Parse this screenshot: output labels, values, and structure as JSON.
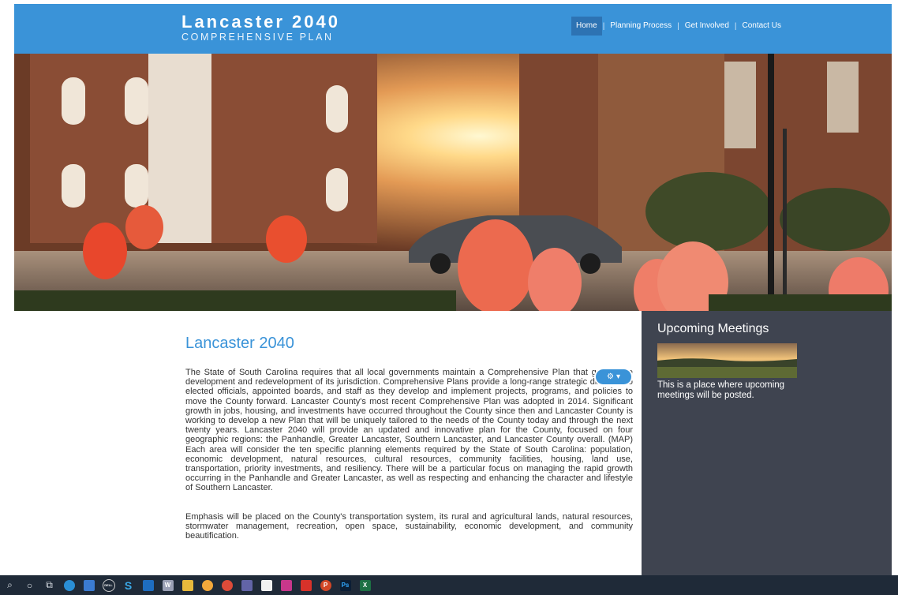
{
  "header": {
    "title": "Lancaster 2040",
    "subtitle": "COMPREHENSIVE PLAN",
    "nav": [
      {
        "label": "Home"
      },
      {
        "label": "Planning Process"
      },
      {
        "label": "Get Involved"
      },
      {
        "label": "Contact Us"
      }
    ],
    "separator": "|"
  },
  "main": {
    "title": "Lancaster 2040",
    "paragraphs": [
      "The State of South Carolina requires that all local governments maintain a Comprehensive Plan that guides the development and redevelopment of its jurisdiction. Comprehensive Plans provide a long-range strategic direction to elected officials, appointed boards, and staff as they develop and implement projects, programs, and policies to move the County forward. Lancaster County's most recent Comprehensive Plan was adopted in 2014. Significant growth in jobs, housing, and investments have occurred throughout the County since then and Lancaster County is working to develop a new Plan that will be uniquely tailored to the needs of the County today and through the next twenty years. Lancaster 2040 will provide an updated and innovative plan for the County, focused on four geographic regions: the Panhandle, Greater Lancaster, Southern Lancaster, and Lancaster County overall. (MAP) Each area will consider the ten specific planning elements required by the State of South Carolina: population, economic development, natural resources, cultural resources, community facilities, housing, land use, transportation, priority investments, and resiliency. There will be a particular focus on managing the rapid growth occurring in the Panhandle and Greater Lancaster, as well as respecting and enhancing the character and lifestyle of Southern Lancaster.",
      "Emphasis will be placed on the County's transportation system, its rural and agricultural lands, natural resources, stormwater management, recreation, open space, sustainability, economic development, and community beautification."
    ],
    "gear_caret": "▾"
  },
  "sidebar": {
    "title": "Upcoming Meetings",
    "text": "This is a place where upcoming meetings will be posted."
  },
  "taskbar": {
    "icons": [
      "search-icon",
      "cortana-icon",
      "task-view-icon",
      "edge-icon",
      "store-icon",
      "dell-icon",
      "skype-icon",
      "outlook-icon",
      "word-icon",
      "file-explorer-icon",
      "chrome-canary-icon",
      "chrome-icon",
      "teams-icon",
      "notepad-icon",
      "photos-icon",
      "acrobat-icon",
      "powerpoint-icon",
      "photoshop-icon",
      "excel-icon"
    ],
    "labels": {
      "skype": "S",
      "word": "W",
      "powerpoint": "P",
      "photoshop": "Ps",
      "excel": "X",
      "dell": "DELL"
    }
  },
  "colors": {
    "brand": "#3a93d8",
    "nav_active": "#2d73b3",
    "sidebar": "#3f4450",
    "taskbar": "#1f2a38"
  }
}
